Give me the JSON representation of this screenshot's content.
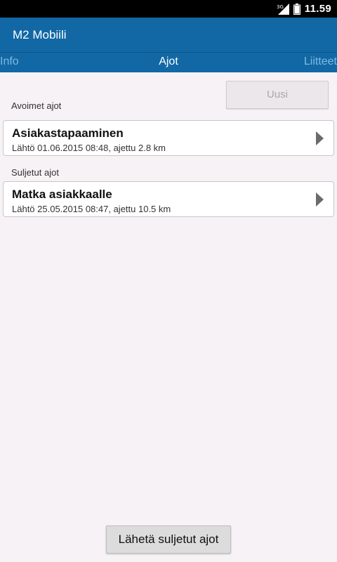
{
  "status_bar": {
    "network_type": "3G",
    "time": "11.59",
    "icons": [
      "signal-icon",
      "battery-icon"
    ]
  },
  "app": {
    "title": "M2 Mobiili",
    "colors": {
      "action_bar": "#1268a5",
      "tab_inactive": "#7fb8e0",
      "background": "#f6f2f5"
    }
  },
  "tabs": [
    {
      "label": "Info",
      "selected": false
    },
    {
      "label": "Ajot",
      "selected": true
    },
    {
      "label": "Liitteet",
      "selected": false
    }
  ],
  "new_button": {
    "label": "Uusi",
    "enabled": false
  },
  "open_trips": {
    "label": "Avoimet ajot",
    "items": [
      {
        "title": "Asiakastapaaminen",
        "detail": "Lähtö 01.06.2015 08:48, ajettu 2.8 km"
      }
    ]
  },
  "closed_trips": {
    "label": "Suljetut ajot",
    "items": [
      {
        "title": "Matka asiakkaalle",
        "detail": "Lähtö 25.05.2015 08:47, ajettu 10.5 km"
      }
    ]
  },
  "send_button": {
    "label": "Lähetä suljetut ajot"
  }
}
